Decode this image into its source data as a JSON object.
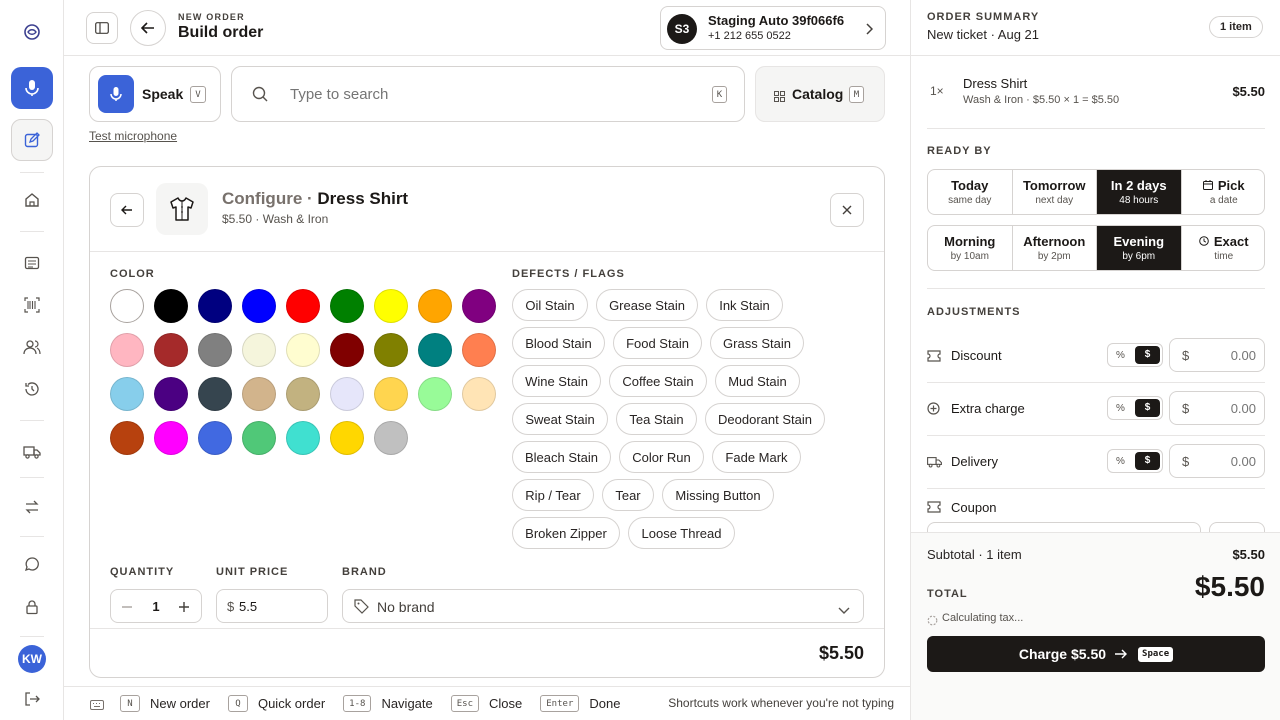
{
  "header": {
    "kicker": "NEW ORDER",
    "title": "Build order",
    "customer": {
      "initials": "S3",
      "name": "Staging Auto 39f066f6",
      "phone": "+1 212 655 0522"
    }
  },
  "input_bar": {
    "speak_label": "Speak",
    "speak_key": "V",
    "search_placeholder": "Type to search",
    "search_key": "K",
    "catalog_label": "Catalog",
    "catalog_key": "M",
    "test_mic": "Test microphone"
  },
  "configure": {
    "prefix": "Configure · ",
    "item_name": "Dress Shirt",
    "subtitle": "$5.50 · Wash & Iron",
    "color_label": "COLOR",
    "colors": [
      "#ffffff",
      "#000000",
      "#000080",
      "#0000ff",
      "#ff0000",
      "#008000",
      "#ffff00",
      "#ffa500",
      "#800080",
      "#ffb6c1",
      "#a52a2a",
      "#808080",
      "#f5f5dc",
      "#fffdd0",
      "#800000",
      "#808000",
      "#008080",
      "#ff7f50",
      "#87ceeb",
      "#4b0082",
      "#36454f",
      "#d2b48c",
      "#c2b280",
      "#e6e6fa",
      "#ffd54f",
      "#98fb98",
      "#ffe4b5",
      "#b7410e",
      "#ff00ff",
      "#4169e1",
      "#50c878",
      "#40e0d0",
      "#ffd700",
      "#c0c0c0"
    ],
    "defects_label": "DEFECTS / FLAGS",
    "defects": [
      [
        "Oil Stain",
        "Grease Stain",
        "Ink Stain"
      ],
      [
        "Blood Stain",
        "Food Stain",
        "Grass Stain"
      ],
      [
        "Wine Stain",
        "Coffee Stain",
        "Mud Stain"
      ],
      [
        "Sweat Stain",
        "Tea Stain",
        "Deodorant Stain"
      ],
      [
        "Bleach Stain",
        "Color Run",
        "Fade Mark"
      ],
      [
        "Rip / Tear",
        "Tear",
        "Missing Button"
      ],
      [
        "Broken Zipper",
        "Loose Thread"
      ]
    ],
    "quantity_label": "QUANTITY",
    "quantity": "1",
    "unit_price_label": "UNIT PRICE",
    "currency": "$",
    "unit_price": "5.5",
    "brand_label": "BRAND",
    "brand_value": "No brand",
    "line_total": "$5.50"
  },
  "footer": {
    "shortcuts": [
      {
        "key": "N",
        "label": "New order"
      },
      {
        "key": "Q",
        "label": "Quick order"
      },
      {
        "key": "1-8",
        "label": "Navigate"
      },
      {
        "key": "Esc",
        "label": "Close"
      },
      {
        "key": "Enter",
        "label": "Done"
      }
    ],
    "hint": "Shortcuts work whenever you're not typing"
  },
  "summary": {
    "kicker": "ORDER SUMMARY",
    "subtitle": "New ticket · Aug 21",
    "count_badge": "1 item",
    "line": {
      "qty": "1×",
      "name": "Dress Shirt",
      "detail": "Wash & Iron · $5.50 × 1 = $5.50",
      "price": "$5.50"
    },
    "ready_label": "READY BY",
    "day_options": [
      {
        "t": "Today",
        "s": "same day"
      },
      {
        "t": "Tomorrow",
        "s": "next day"
      },
      {
        "t": "In 2 days",
        "s": "48 hours"
      },
      {
        "t": "Pick",
        "s": "a date"
      }
    ],
    "day_selected": "In 2 days",
    "time_options": [
      {
        "t": "Morning",
        "s": "by 10am"
      },
      {
        "t": "Afternoon",
        "s": "by 2pm"
      },
      {
        "t": "Evening",
        "s": "by 6pm"
      },
      {
        "t": "Exact",
        "s": "time"
      }
    ],
    "time_selected": "Evening",
    "adjustments_label": "ADJUSTMENTS",
    "adjustments": [
      {
        "label": "Discount",
        "pct": "%",
        "dollar": "$",
        "currency": "$",
        "placeholder": "0.00"
      },
      {
        "label": "Extra charge",
        "pct": "%",
        "dollar": "$",
        "currency": "$",
        "placeholder": "0.00"
      },
      {
        "label": "Delivery",
        "pct": "%",
        "dollar": "$",
        "currency": "$",
        "placeholder": "0.00"
      }
    ],
    "coupon_label": "Coupon",
    "subtotal_label": "Subtotal · 1 item",
    "subtotal_value": "$5.50",
    "total_label": "TOTAL",
    "total_value": "$5.50",
    "tax_status": "Calculating tax...",
    "charge_label": "Charge $5.50",
    "charge_key": "Space"
  },
  "rail": {
    "avatar": "KW"
  },
  "colors": {
    "accent": "#3b63d8",
    "dark": "#1c1917",
    "border": "#d6d3d1"
  }
}
